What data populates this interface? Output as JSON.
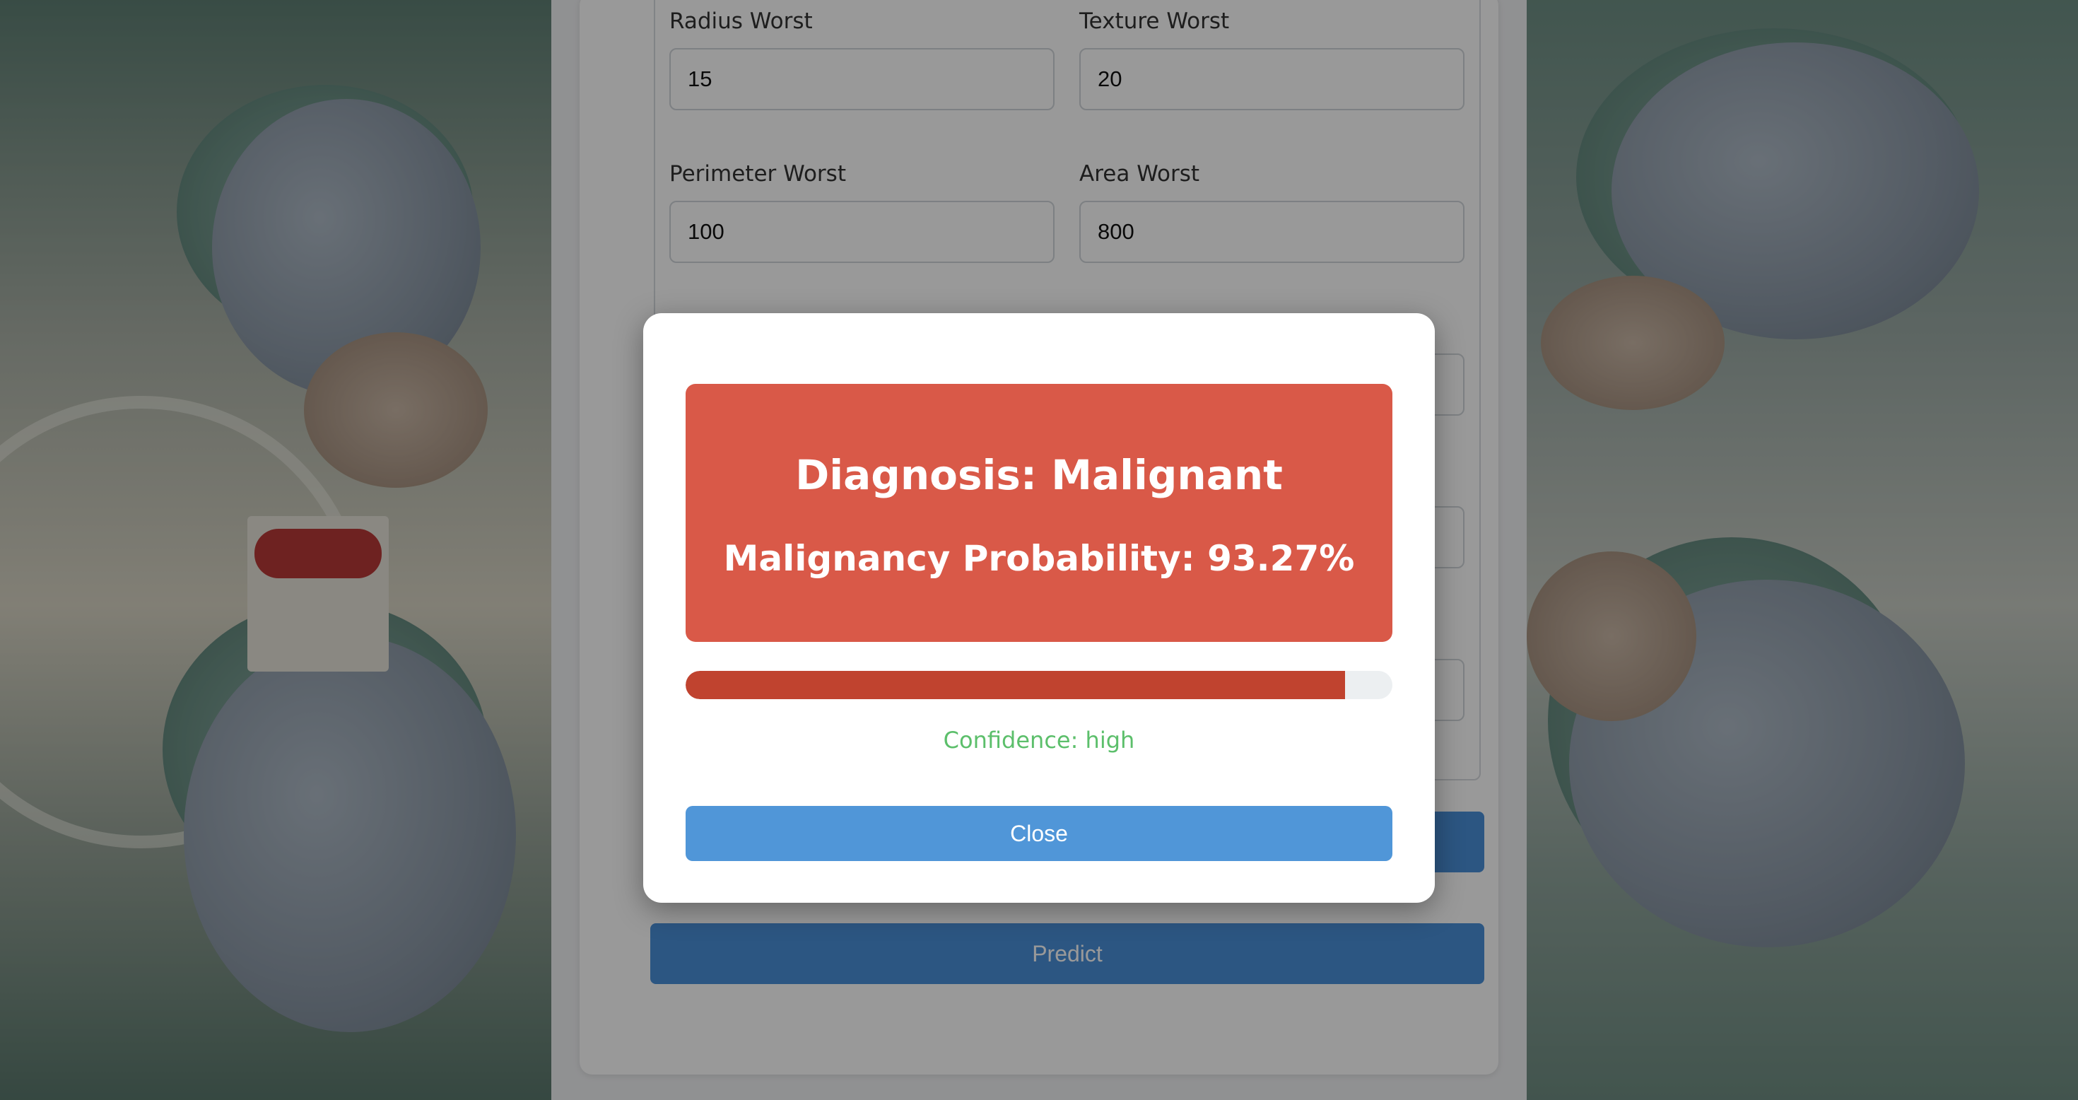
{
  "form": {
    "fields": [
      {
        "label": "Radius Worst",
        "value": "15"
      },
      {
        "label": "Texture Worst",
        "value": "20"
      },
      {
        "label": "Perimeter Worst",
        "value": "100"
      },
      {
        "label": "Area Worst",
        "value": "800"
      }
    ],
    "predict_label": "Predict"
  },
  "modal": {
    "diagnosis": "Diagnosis: Malignant",
    "probability_text": "Malignancy Probability: 93.27%",
    "probability": 0.9327,
    "confidence": "Confidence: high",
    "close_label": "Close",
    "colors": {
      "result_bg": "#d95948",
      "bar_fill": "#c0432f",
      "bar_track": "#eceff1",
      "confidence_text": "#5cbf6b",
      "close_button": "#5096d8"
    }
  }
}
